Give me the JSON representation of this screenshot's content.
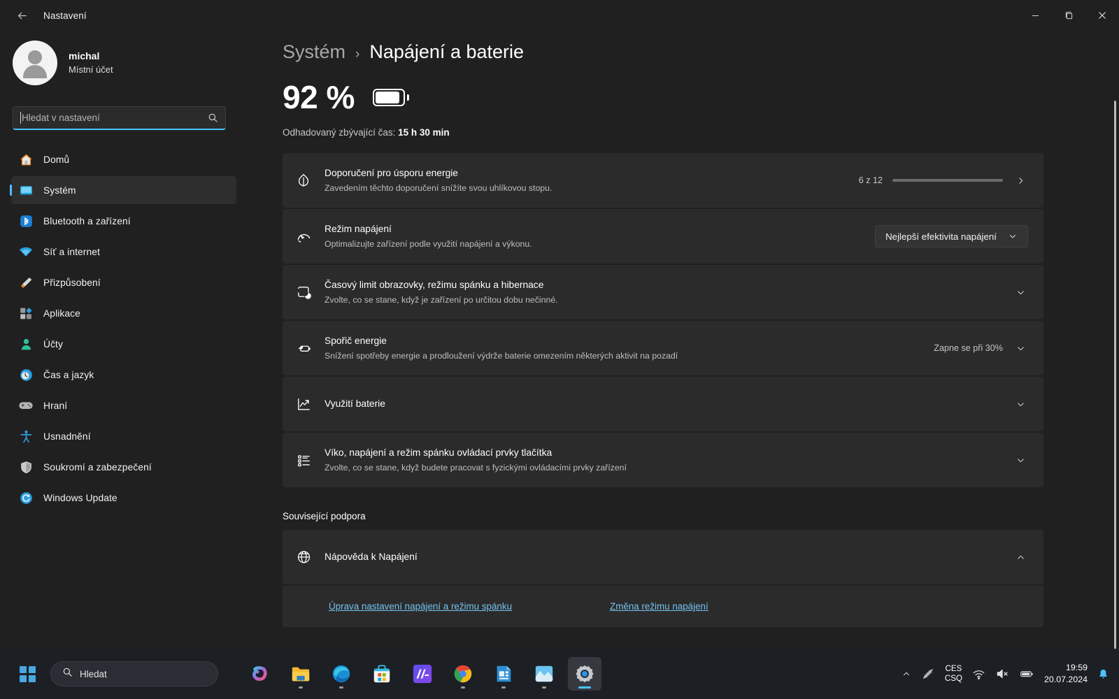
{
  "window": {
    "title": "Nastavení",
    "back_icon": "back-arrow-icon",
    "minimize_icon": "minimize-icon",
    "maximize_icon": "maximize-icon",
    "close_icon": "close-icon"
  },
  "account": {
    "name": "michal",
    "type": "Místní účet",
    "avatar_icon": "avatar-icon"
  },
  "search": {
    "placeholder": "Hledat v nastavení",
    "value": "",
    "icon": "search-icon"
  },
  "sidebar": {
    "items": [
      {
        "label": "Domů",
        "icon": "home-icon",
        "active": false
      },
      {
        "label": "Systém",
        "icon": "monitor-icon",
        "active": true
      },
      {
        "label": "Bluetooth a zařízení",
        "icon": "bluetooth-icon",
        "active": false
      },
      {
        "label": "Síť a internet",
        "icon": "wifi-icon",
        "active": false
      },
      {
        "label": "Přizpůsobení",
        "icon": "paintbrush-icon",
        "active": false
      },
      {
        "label": "Aplikace",
        "icon": "apps-icon",
        "active": false
      },
      {
        "label": "Účty",
        "icon": "person-icon",
        "active": false
      },
      {
        "label": "Čas a jazyk",
        "icon": "clock-icon",
        "active": false
      },
      {
        "label": "Hraní",
        "icon": "gamepad-icon",
        "active": false
      },
      {
        "label": "Usnadnění",
        "icon": "accessibility-icon",
        "active": false
      },
      {
        "label": "Soukromí a zabezpečení",
        "icon": "shield-icon",
        "active": false
      },
      {
        "label": "Windows Update",
        "icon": "update-icon",
        "active": false
      }
    ]
  },
  "breadcrumb": {
    "parent": "Systém",
    "separator": "›",
    "current": "Napájení a baterie"
  },
  "battery": {
    "percent_label": "92 %",
    "percent_value": 92,
    "icon": "battery-icon",
    "remaining_label": "Odhadovaný zbývající čas:",
    "remaining_value": "15 h 30 min"
  },
  "cards": [
    {
      "icon": "leaf-icon",
      "title": "Doporučení pro úsporu energie",
      "subtitle": "Zavedením těchto doporučení snížíte svou uhlíkovou stopu.",
      "meta": "6 z 12",
      "progress": {
        "current": 6,
        "total": 12,
        "percent": 50,
        "fill_color": "#1f91e8",
        "track_color": "#6b6b6b"
      },
      "chevron": "chevron-right-icon"
    },
    {
      "icon": "gauge-icon",
      "title": "Režim napájení",
      "subtitle": "Optimalizujte zařízení podle využití napájení a výkonu.",
      "combo_value": "Nejlepší efektivita napájení",
      "chevron": "chevron-down-icon"
    },
    {
      "icon": "screen-sleep-icon",
      "title": "Časový limit obrazovky, režimu spánku a hibernace",
      "subtitle": "Zvolte, co se stane, když je zařízení po určitou dobu nečinné.",
      "chevron": "chevron-down-icon"
    },
    {
      "icon": "battery-saver-icon",
      "title": "Spořič energie",
      "subtitle": "Snížení spotřeby energie a prodloužení výdrže baterie omezením některých aktivit na pozadí",
      "meta": "Zapne se při 30%",
      "chevron": "chevron-down-icon"
    },
    {
      "icon": "chart-icon",
      "title": "Využití baterie",
      "subtitle": "",
      "chevron": "chevron-down-icon"
    },
    {
      "icon": "list-icon",
      "title": "Víko, napájení a režim spánku ovládací prvky tlačítka",
      "subtitle": "Zvolte, co se stane, když budete pracovat s fyzickými ovládacími prvky zařízení",
      "chevron": "chevron-down-icon"
    }
  ],
  "support": {
    "section_title": "Související podpora",
    "help_icon": "globe-help-icon",
    "help_title": "Nápověda k Napájení",
    "help_chevron": "chevron-up-icon",
    "links": [
      "Úprava nastavení napájení a režimu spánku",
      "Změna režimu napájení"
    ]
  },
  "taskbar": {
    "start_icon": "windows-start-icon",
    "search_placeholder": "Hledat",
    "search_icon": "search-icon",
    "apps": [
      {
        "name": "copilot",
        "label": "Copilot",
        "running": false,
        "active": false
      },
      {
        "name": "file-explorer",
        "label": "Průzkumník souborů",
        "running": true,
        "active": false
      },
      {
        "name": "edge",
        "label": "Microsoft Edge",
        "running": true,
        "active": false
      },
      {
        "name": "store",
        "label": "Microsoft Store",
        "running": false,
        "active": false
      },
      {
        "name": "ma-app",
        "label": "MA",
        "running": false,
        "active": false
      },
      {
        "name": "chrome",
        "label": "Google Chrome",
        "running": true,
        "active": false
      },
      {
        "name": "office-doc",
        "label": "Dokument",
        "running": true,
        "active": false
      },
      {
        "name": "photos",
        "label": "Fotky",
        "running": true,
        "active": false
      },
      {
        "name": "settings",
        "label": "Nastavení",
        "running": true,
        "active": true
      }
    ],
    "tray": {
      "overflow_icon": "chevron-up-icon",
      "pen_icon": "pen-disabled-icon",
      "lang_line1": "CES",
      "lang_line2": "CSQ",
      "wifi_icon": "wifi-icon",
      "volume_icon": "volume-muted-icon",
      "battery_icon": "battery-icon",
      "time": "19:59",
      "date": "20.07.2024",
      "notification_icon": "bell-icon"
    }
  },
  "colors": {
    "accent": "#4cc2ff",
    "progress": "#1f91e8",
    "link": "#74c3ef",
    "card_bg": "#2b2b2b",
    "page_bg": "#202020",
    "taskbar_bg": "#1c1f24"
  }
}
